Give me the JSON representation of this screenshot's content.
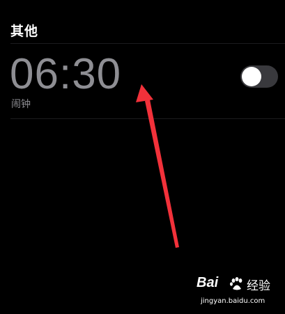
{
  "section": {
    "title": "其他"
  },
  "alarm": {
    "time": "06:30",
    "label": "闹钟",
    "enabled": false
  },
  "colors": {
    "background": "#000000",
    "time_text": "#8e8e93",
    "toggle_off": "#39393d",
    "knob": "#ffffff",
    "arrow": "#f2313a"
  },
  "watermark": {
    "logo_left": "Bai",
    "logo_right": "经验",
    "url": "jingyan.baidu.com"
  }
}
